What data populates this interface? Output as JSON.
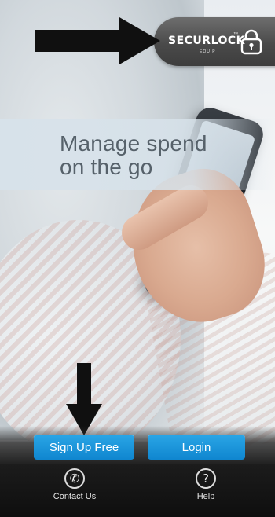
{
  "logo": {
    "name": "SECURLOCK",
    "trademark": "™",
    "sub": "EQUIP",
    "icon": "padlock-icon"
  },
  "headline": [
    "Manage spend",
    "on the go"
  ],
  "buttons": {
    "signup": "Sign Up Free",
    "login": "Login"
  },
  "tabs": [
    {
      "label": "Contact Us",
      "icon": "phone-icon"
    },
    {
      "label": "Help",
      "icon": "question-icon"
    }
  ],
  "annotations": {
    "arrow_right": "arrow-right-icon",
    "arrow_down": "arrow-down-icon"
  },
  "colors": {
    "button": "#1793d8",
    "tabbar": "#111111",
    "logo_pill": "#555555",
    "headline": "#56616a"
  }
}
